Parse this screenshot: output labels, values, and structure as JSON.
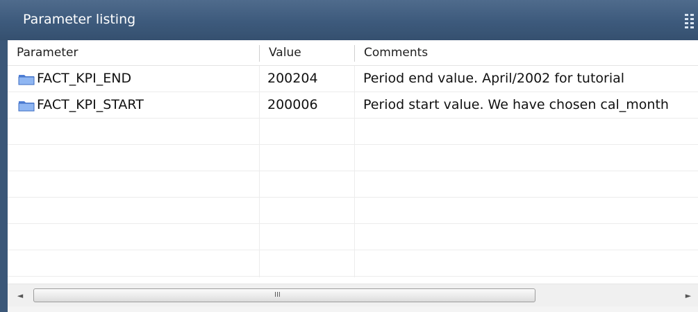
{
  "window": {
    "title": "Parameter listing"
  },
  "table": {
    "columns": [
      {
        "label": "Parameter"
      },
      {
        "label": "Value"
      },
      {
        "label": "Comments"
      }
    ],
    "rows": [
      {
        "parameter": "FACT_KPI_END",
        "value": "200204",
        "comment": "Period end value. April/2002 for tutorial",
        "icon": "folder-icon"
      },
      {
        "parameter": "FACT_KPI_START",
        "value": "200006",
        "comment": "Period start value. We have chosen cal_month",
        "icon": "folder-icon"
      }
    ]
  },
  "scrollbar": {
    "left_arrow": "◄",
    "right_arrow": "►",
    "grip": "III"
  },
  "colors": {
    "titlebar": "#3d5a7c",
    "title_text": "#ffffff",
    "folder": "#6f9be6"
  }
}
